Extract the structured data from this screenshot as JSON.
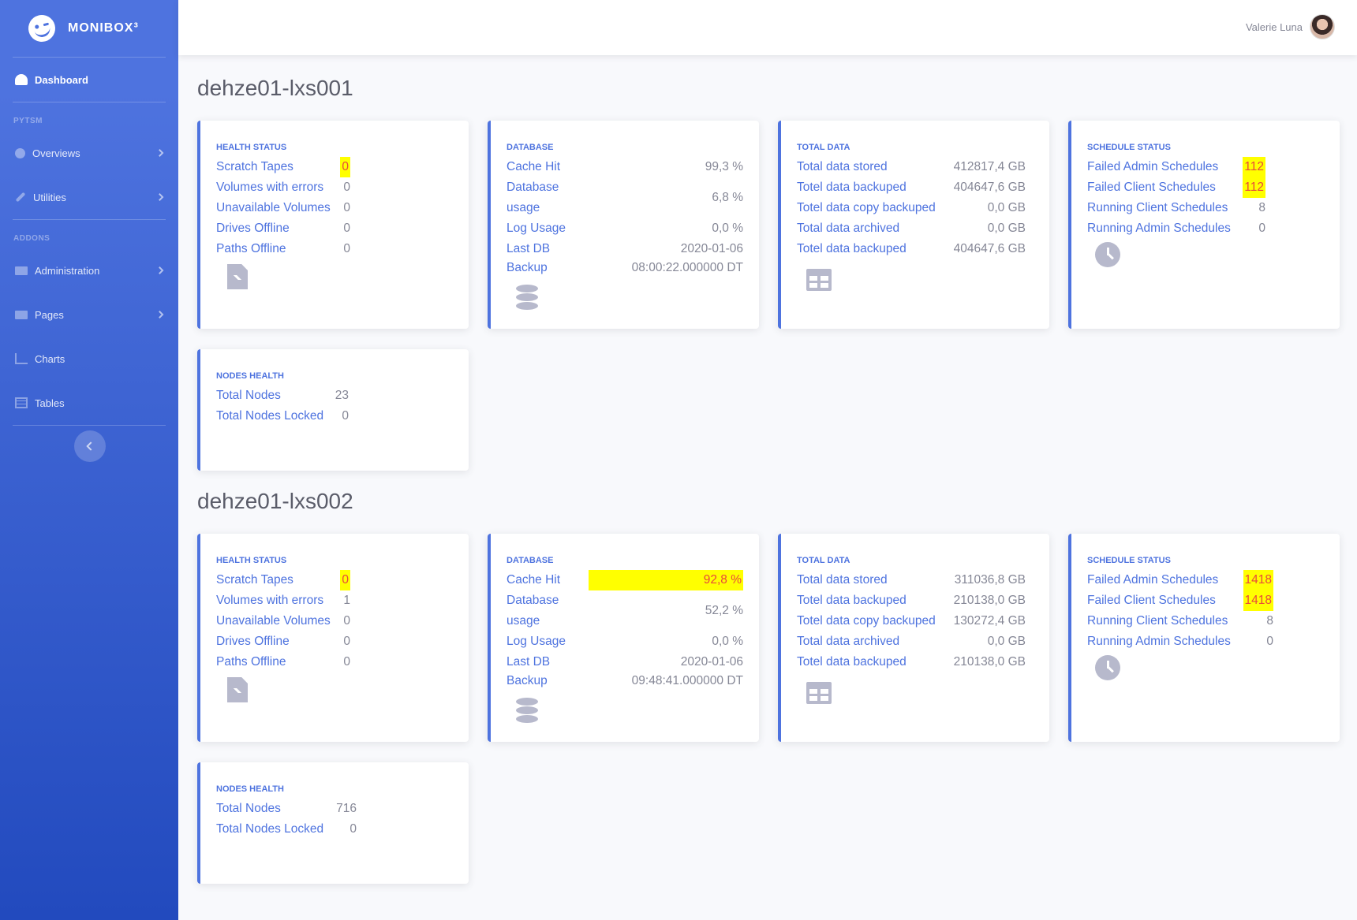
{
  "brand": {
    "name": "MONIBOX³"
  },
  "sidebar": {
    "dashboard": "Dashboard",
    "heading_pytsm": "PYTSM",
    "overviews": "Overviews",
    "utilities": "Utilities",
    "heading_addons": "ADDONS",
    "administration": "Administration",
    "pages": "Pages",
    "charts": "Charts",
    "tables": "Tables"
  },
  "topbar": {
    "user_name": "Valerie Luna"
  },
  "servers": [
    {
      "name": "dehze01-lxs001",
      "health": {
        "title": "HEALTH STATUS",
        "scratch_tapes_label": "Scratch Tapes",
        "scratch_tapes": "0",
        "volumes_errors_label": "Volumes with errors",
        "volumes_errors": "0",
        "unavailable_label": "Unavailable Volumes",
        "unavailable": "0",
        "drives_offline_label": "Drives Offline",
        "drives_offline": "0",
        "paths_offline_label": "Paths Offline",
        "paths_offline": "0"
      },
      "database": {
        "title": "DATABASE",
        "cache_hit_label": "Cache Hit",
        "cache_hit": "99,3 %",
        "db_usage_label_1": "Database",
        "db_usage_label_2": "usage",
        "db_usage": "6,8 %",
        "log_usage_label": "Log Usage",
        "log_usage": "0,0 %",
        "last_db_label": "Last DB",
        "last_db_date": "2020-01-06",
        "backup_label": "Backup",
        "backup_time": "08:00:22.000000 DT"
      },
      "total": {
        "title": "TOTAL DATA",
        "stored_label": "Total data stored",
        "stored": "412817,4 GB",
        "backuped_label": "Totel data backuped",
        "backuped": "404647,6 GB",
        "copy_label": "Totel data copy backuped",
        "copy": "0,0 GB",
        "archived_label": "Total data archived",
        "archived": "0,0 GB",
        "backuped2_label": "Totel data backuped",
        "backuped2": "404647,6 GB"
      },
      "schedule": {
        "title": "SCHEDULE STATUS",
        "failed_admin_label": "Failed Admin Schedules",
        "failed_admin": "112",
        "failed_client_label": "Failed Client Schedules",
        "failed_client": "112",
        "running_client_label": "Running Client Schedules",
        "running_client": "8",
        "running_admin_label": "Running Admin Schedules",
        "running_admin": "0"
      },
      "nodes": {
        "title": "NODES HEALTH",
        "total_label": "Total Nodes",
        "total": "23",
        "locked_label": "Total Nodes Locked",
        "locked": "0"
      }
    },
    {
      "name": "dehze01-lxs002",
      "health": {
        "title": "HEALTH STATUS",
        "scratch_tapes_label": "Scratch Tapes",
        "scratch_tapes": "0",
        "volumes_errors_label": "Volumes with errors",
        "volumes_errors": "1",
        "unavailable_label": "Unavailable Volumes",
        "unavailable": "0",
        "drives_offline_label": "Drives Offline",
        "drives_offline": "0",
        "paths_offline_label": "Paths Offline",
        "paths_offline": "0"
      },
      "database": {
        "title": "DATABASE",
        "cache_hit_label": "Cache Hit",
        "cache_hit": "92,8 %",
        "db_usage_label_1": "Database",
        "db_usage_label_2": "usage",
        "db_usage": "52,2 %",
        "log_usage_label": "Log Usage",
        "log_usage": "0,0 %",
        "last_db_label": "Last DB",
        "last_db_date": "2020-01-06",
        "backup_label": "Backup",
        "backup_time": "09:48:41.000000 DT"
      },
      "total": {
        "title": "TOTAL DATA",
        "stored_label": "Total data stored",
        "stored": "311036,8 GB",
        "backuped_label": "Totel data backuped",
        "backuped": "210138,0 GB",
        "copy_label": "Totel data copy backuped",
        "copy": "130272,4 GB",
        "archived_label": "Total data archived",
        "archived": "0,0 GB",
        "backuped2_label": "Totel data backuped",
        "backuped2": "210138,0 GB"
      },
      "schedule": {
        "title": "SCHEDULE STATUS",
        "failed_admin_label": "Failed Admin Schedules",
        "failed_admin": "1418",
        "failed_client_label": "Failed Client Schedules",
        "failed_client": "1418",
        "running_client_label": "Running Client Schedules",
        "running_client": "8",
        "running_admin_label": "Running Admin Schedules",
        "running_admin": "0"
      },
      "nodes": {
        "title": "NODES HEALTH",
        "total_label": "Total Nodes",
        "total": "716",
        "locked_label": "Total Nodes Locked",
        "locked": "0"
      }
    }
  ],
  "colors": {
    "primary": "#4e73df",
    "highlight": "#ffff00",
    "alert_text": "#e74a3b"
  },
  "icons": [
    "file-medical-icon",
    "database-icon",
    "table-icon",
    "clock-icon"
  ]
}
